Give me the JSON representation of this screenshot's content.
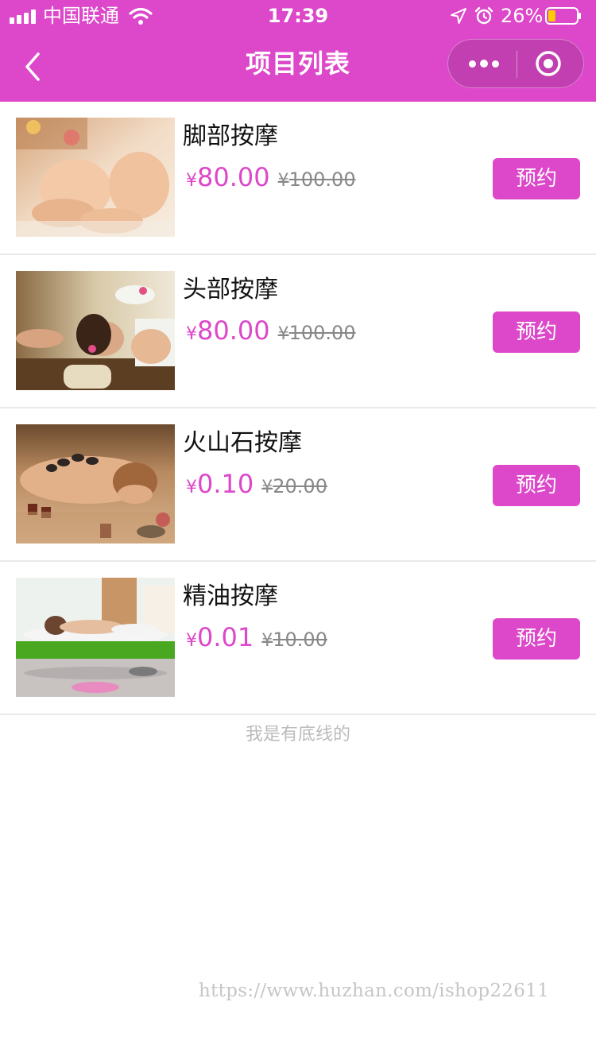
{
  "status_bar": {
    "carrier": "中国联通",
    "time": "17:39",
    "battery_percent": "26%",
    "battery_level": 0.26,
    "icons": [
      "signal-icon",
      "wifi-icon",
      "location-arrow-icon",
      "alarm-icon",
      "battery-icon"
    ]
  },
  "nav": {
    "title": "项目列表",
    "back_icon": "chevron-left-icon",
    "more_icon": "more-dots-icon",
    "close_icon": "target-circle-icon"
  },
  "items": [
    {
      "name": "脚部按摩",
      "currency": "¥",
      "price": "80.00",
      "original_price": "100.00",
      "button": "预约",
      "image": "foot-massage-photo"
    },
    {
      "name": "头部按摩",
      "currency": "¥",
      "price": "80.00",
      "original_price": "100.00",
      "button": "预约",
      "image": "head-massage-photo"
    },
    {
      "name": "火山石按摩",
      "currency": "¥",
      "price": "0.10",
      "original_price": "20.00",
      "button": "预约",
      "image": "hot-stone-massage-photo"
    },
    {
      "name": "精油按摩",
      "currency": "¥",
      "price": "0.01",
      "original_price": "10.00",
      "button": "预约",
      "image": "oil-massage-photo"
    }
  ],
  "footer": {
    "text": "我是有底线的"
  },
  "watermark": "https://www.huzhan.com/ishop22611",
  "colors": {
    "accent": "#dc48c9",
    "strike_price": "#888888",
    "divider": "#e9e9e9"
  }
}
